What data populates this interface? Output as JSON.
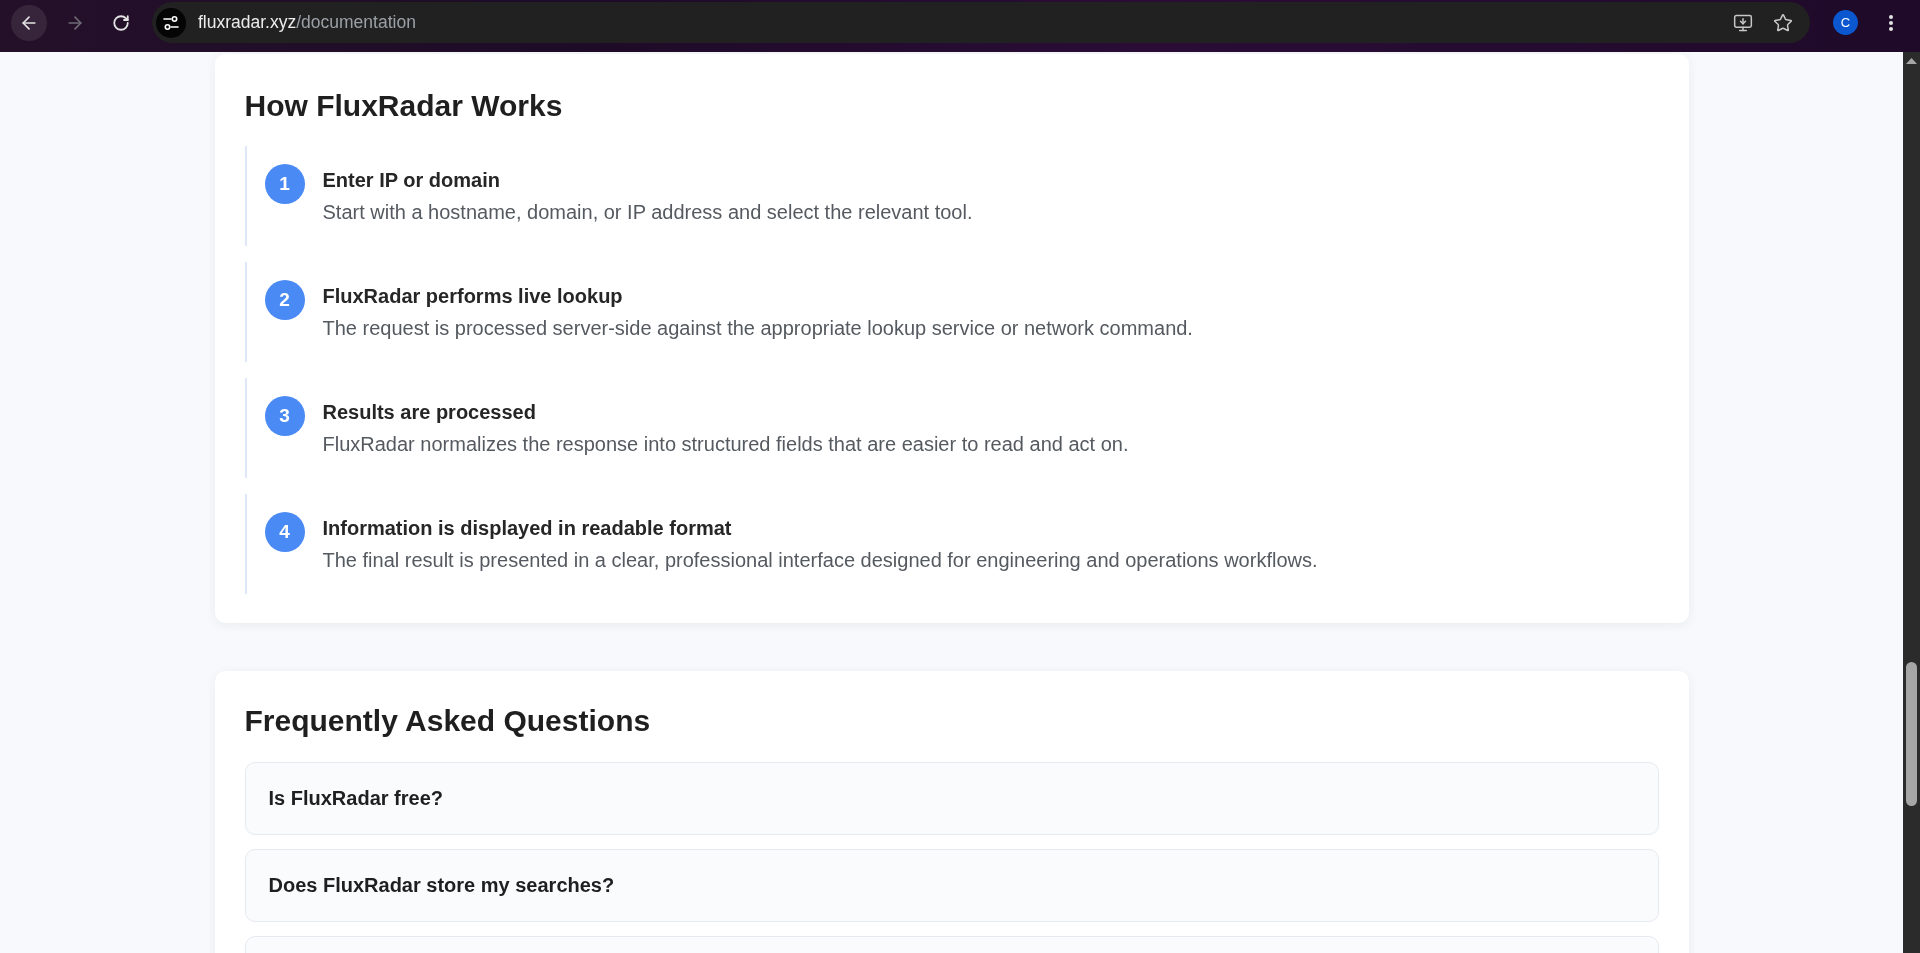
{
  "browser": {
    "url_host": "fluxradar.xyz",
    "url_path": "/documentation",
    "avatar_letter": "C"
  },
  "how_it_works": {
    "title": "How FluxRadar Works",
    "steps": [
      {
        "number": "1",
        "title": "Enter IP or domain",
        "description": "Start with a hostname, domain, or IP address and select the relevant tool."
      },
      {
        "number": "2",
        "title": "FluxRadar performs live lookup",
        "description": "The request is processed server-side against the appropriate lookup service or network command."
      },
      {
        "number": "3",
        "title": "Results are processed",
        "description": "FluxRadar normalizes the response into structured fields that are easier to read and act on."
      },
      {
        "number": "4",
        "title": "Information is displayed in readable format",
        "description": "The final result is presented in a clear, professional interface designed for engineering and operations workflows."
      }
    ]
  },
  "faq": {
    "title": "Frequently Asked Questions",
    "items": [
      {
        "question": "Is FluxRadar free?"
      },
      {
        "question": "Does FluxRadar store my searches?"
      }
    ],
    "next_item_cut_off": true
  }
}
